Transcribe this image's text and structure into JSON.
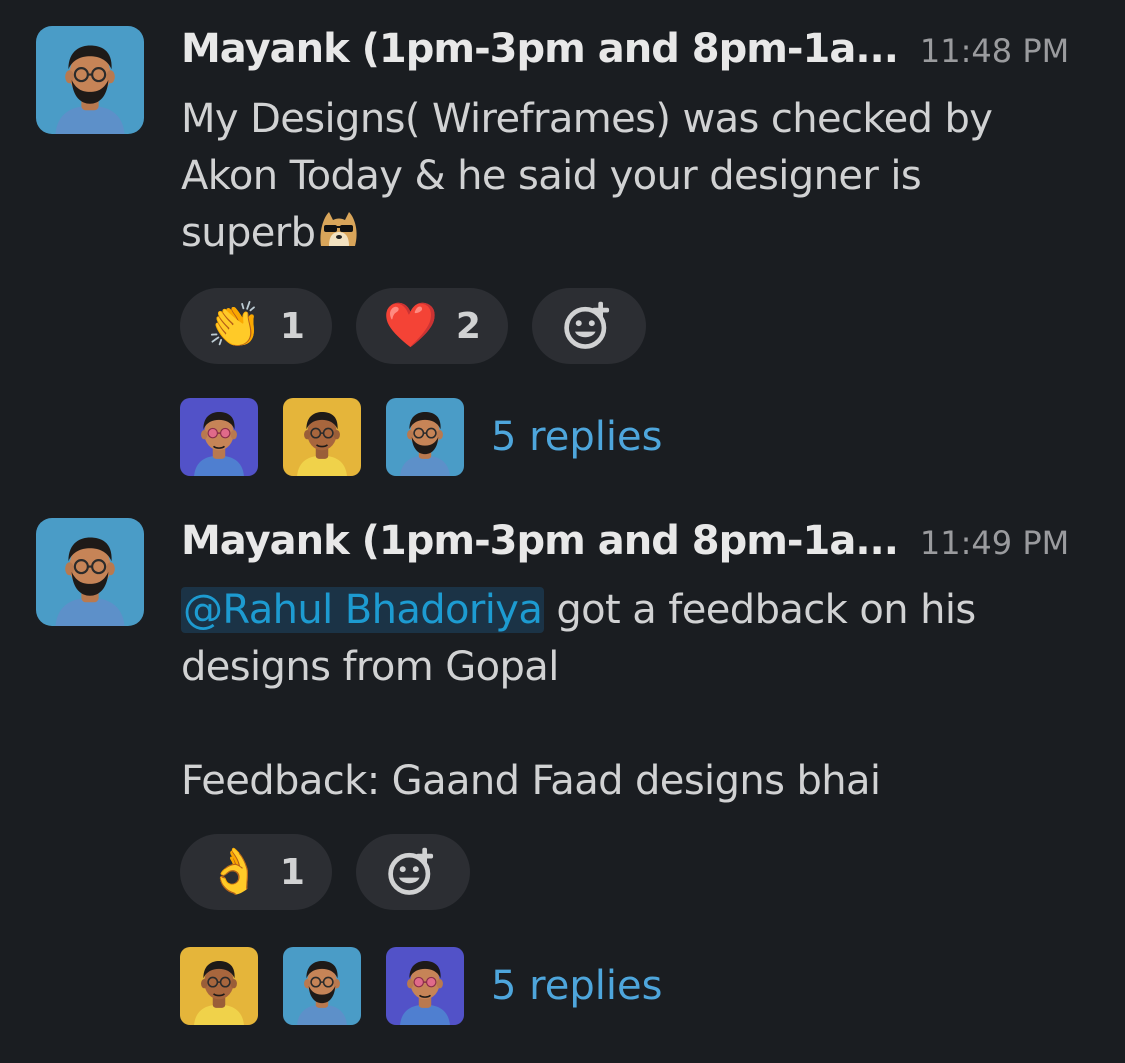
{
  "messages": [
    {
      "sender": "Mayank (1pm-3pm and 8pm-1a...",
      "timestamp": "11:48 PM",
      "avatar_color": "#4a9cc7",
      "body_lines": [
        "My Designs( Wireframes) was checked by",
        "Akon Today & he said your designer is",
        "superb"
      ],
      "inline_emoji": "cool-doge-icon",
      "reactions": [
        {
          "emoji": "👏",
          "icon": "clapping-hands-icon",
          "count": "1"
        },
        {
          "emoji": "❤️",
          "icon": "red-heart-icon",
          "count": "2"
        }
      ],
      "reply_avatars": [
        {
          "icon": "avatar-purple-icon",
          "color": "#5252c8"
        },
        {
          "icon": "avatar-yellow-icon",
          "color": "#e5b53a"
        },
        {
          "icon": "avatar-blue-icon",
          "color": "#4a9cc7"
        }
      ],
      "replies_label": "5 replies"
    },
    {
      "sender": "Mayank (1pm-3pm and 8pm-1a...",
      "timestamp": "11:49 PM",
      "avatar_color": "#4a9cc7",
      "mention": "@Rahul Bhadoriya",
      "line1_rest": " got a feedback on his",
      "line2": "designs from Gopal",
      "line3": "Feedback:  Gaand Faad designs bhai",
      "reactions": [
        {
          "emoji": "👌",
          "icon": "ok-hand-icon",
          "count": "1"
        }
      ],
      "reply_avatars": [
        {
          "icon": "avatar-yellow-icon",
          "color": "#e5b53a"
        },
        {
          "icon": "avatar-blue-icon",
          "color": "#4a9cc7"
        },
        {
          "icon": "avatar-purple-icon",
          "color": "#5252c8"
        }
      ],
      "replies_label": "5 replies"
    }
  ],
  "colors": {
    "background": "#1a1d21",
    "pill": "#2c2e33",
    "link": "#4ea6dc",
    "mention_bg": "#1b3346"
  }
}
